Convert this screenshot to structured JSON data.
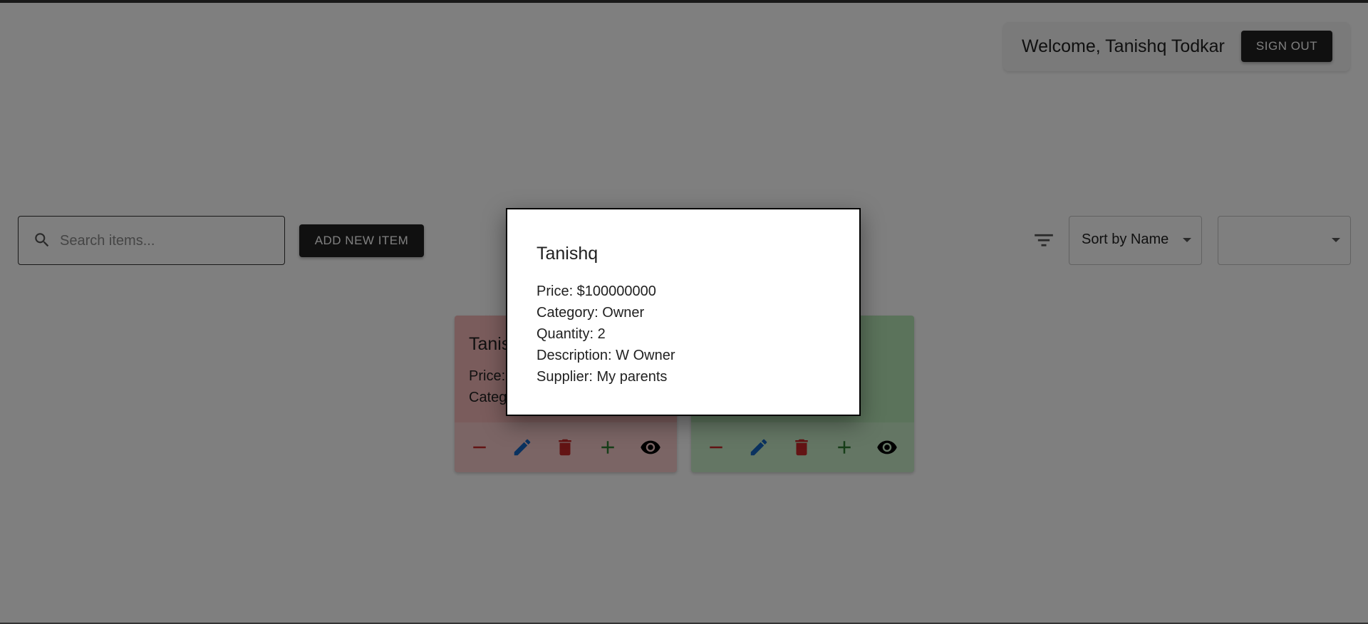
{
  "header": {
    "welcome_text": "Welcome, Tanishq Todkar",
    "sign_out_label": "SIGN OUT"
  },
  "toolbar": {
    "search_placeholder": "Search items...",
    "search_value": "",
    "add_item_label": "ADD NEW ITEM",
    "sort_selected": "Sort by Name",
    "second_selected": ""
  },
  "cards": [
    {
      "title": "Tanis",
      "price_label": "Price:",
      "category_label": "Categ",
      "color": "#f4b8b8"
    },
    {
      "title": "",
      "color": "#b6e6b6"
    }
  ],
  "card_actions": [
    "remove-icon",
    "edit-icon",
    "delete-icon",
    "add-icon",
    "view-icon"
  ],
  "modal": {
    "title": "Tanishq",
    "price": "Price: $100000000",
    "category": "Category: Owner",
    "quantity": "Quantity: 2",
    "description": "Description: W Owner",
    "supplier": "Supplier: My parents"
  },
  "colors": {
    "button_dark": "#212121",
    "remove": "#c62828",
    "edit": "#1565c0",
    "delete": "#c62828",
    "add": "#2e7d32",
    "view": "#000000"
  }
}
